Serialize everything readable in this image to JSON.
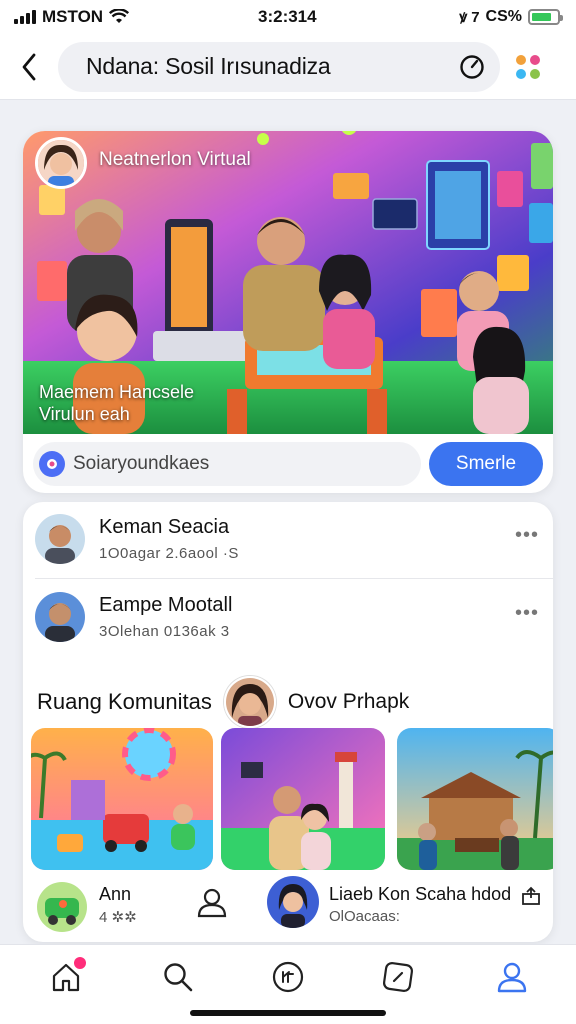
{
  "status_bar": {
    "carrier": "MSTON",
    "time": "3:2:314",
    "battery_text": "CS%",
    "indicators": "ꝟ 7"
  },
  "header": {
    "title": "Ndana: Sosil Irısunadiza",
    "back_icon": "chevron-left-icon",
    "refresh_icon": "refresh-icon",
    "apps_icon": "apps-dots-icon"
  },
  "hero": {
    "title": "Neatnerlon Virtual",
    "caption_line1": "Maemem Hancsele",
    "caption_line2": "Virulun eah",
    "search_placeholder": "Soiaryoundkaes",
    "search_button": "Smerle"
  },
  "posts": [
    {
      "name": "Keman Seacia",
      "meta": "1O0agar 2.6aool ·S"
    },
    {
      "name": "Eampe Mootall",
      "meta": "3Olehan 0136ak 3"
    }
  ],
  "community": {
    "title": "Ruang Komunitas",
    "subtitle": "Ovov Prhapk"
  },
  "bottom_items": {
    "left_name": "Ann",
    "left_meta": "4 ✲✲",
    "right_name": "Liaeb Kon Scaha hdod",
    "right_meta": "OlOacaas:"
  },
  "nav": {
    "items": [
      "home-icon",
      "search-icon",
      "reels-icon",
      "explore-icon",
      "profile-icon"
    ],
    "active": "profile-icon"
  },
  "colors": {
    "accent": "#3b74f0",
    "notification": "#ff2d7a",
    "background": "#eef0f5"
  }
}
